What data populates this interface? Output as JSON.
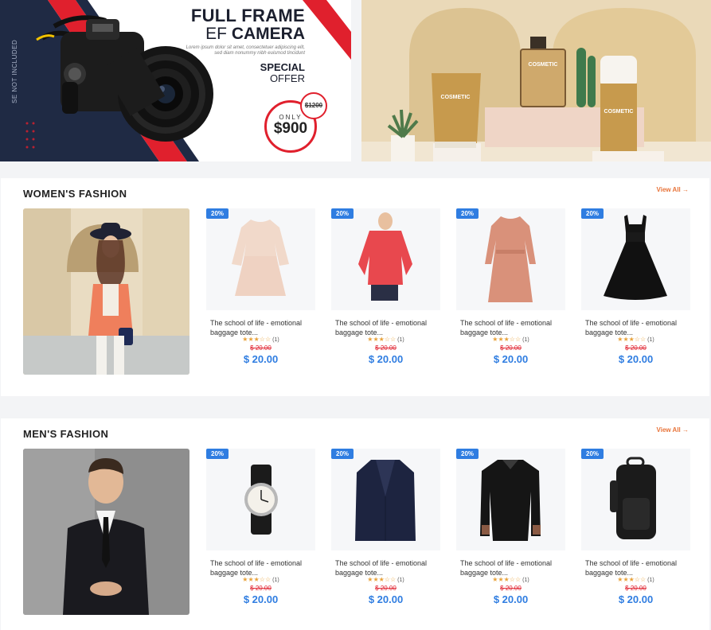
{
  "banner_camera": {
    "title_line1": "FULL FRAME",
    "title_line2_light": "EF",
    "title_line2_bold": "CAMERA",
    "lorem": "Lorem ipsum dolor sit amet, consectetuer adipiscing elit, sed diam nonummy nibh euismod tincidunt",
    "special": "SPECIAL",
    "offer": "OFFER",
    "old_price": "$1200",
    "only": "ONLY",
    "price": "$900",
    "side_note": "SE NOT INCLUDED",
    "accent_color": "#e0202d",
    "dark_color": "#1f2a44"
  },
  "banner_cosmetic": {
    "tube_label": "COSMETIC",
    "bottle_label": "COSMETIC",
    "jar_label": "COSMETIC",
    "bg_color": "#e9d7b5"
  },
  "women": {
    "title": "WOMEN'S FASHION",
    "view_all": "View All  →",
    "products": [
      {
        "badge": "20%",
        "name": "The school of life - emotional baggage tote...",
        "stars": "★★★☆☆",
        "count": "(1)",
        "old_price": "$ 20.00",
        "price": "$ 20.00",
        "icon": "dress-pink-icon"
      },
      {
        "badge": "20%",
        "name": "The school of life - emotional baggage tote...",
        "stars": "★★★☆☆",
        "count": "(1)",
        "old_price": "$ 20.00",
        "price": "$ 20.00",
        "icon": "red-top-icon"
      },
      {
        "badge": "20%",
        "name": "The school of life - emotional baggage tote...",
        "stars": "★★★☆☆",
        "count": "(1)",
        "old_price": "$ 20.00",
        "price": "$ 20.00",
        "icon": "dress-peach-icon"
      },
      {
        "badge": "20%",
        "name": "The school of life - emotional baggage tote...",
        "stars": "★★★☆☆",
        "count": "(1)",
        "old_price": "$ 20.00",
        "price": "$ 20.00",
        "icon": "dress-black-icon"
      }
    ]
  },
  "men": {
    "title": "MEN'S FASHION",
    "view_all": "View All  →",
    "products": [
      {
        "badge": "20%",
        "name": "The school of life - emotional baggage tote...",
        "stars": "★★★☆☆",
        "count": "(1)",
        "old_price": "$ 20.00",
        "price": "$ 20.00",
        "icon": "watch-icon"
      },
      {
        "badge": "20%",
        "name": "The school of life - emotional baggage tote...",
        "stars": "★★★☆☆",
        "count": "(1)",
        "old_price": "$ 20.00",
        "price": "$ 20.00",
        "icon": "blazer-icon"
      },
      {
        "badge": "20%",
        "name": "The school of life - emotional baggage tote...",
        "stars": "★★★☆☆",
        "count": "(1)",
        "old_price": "$ 20.00",
        "price": "$ 20.00",
        "icon": "shirt-icon"
      },
      {
        "badge": "20%",
        "name": "The school of life - emotional baggage tote...",
        "stars": "★★★☆☆",
        "count": "(1)",
        "old_price": "$ 20.00",
        "price": "$ 20.00",
        "icon": "backpack-icon"
      }
    ]
  },
  "colors": {
    "badge": "#2f7de1",
    "price": "#2f7de1",
    "old_price": "#e0202d",
    "view_all": "#e8743a",
    "stars": "#e8a23a"
  }
}
